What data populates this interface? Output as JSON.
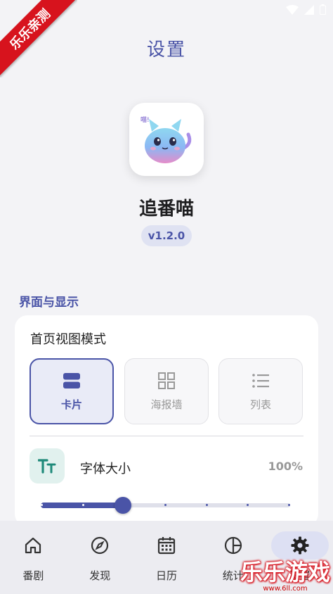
{
  "status_bar": {
    "icons": [
      "wifi-icon",
      "signal-icon",
      "battery-icon"
    ]
  },
  "ribbon": {
    "text": "乐乐亲测"
  },
  "header": {
    "title": "设置"
  },
  "app": {
    "name": "追番喵",
    "version": "v1.2.0",
    "icon_text": "喵!"
  },
  "section": {
    "label": "界面与显示"
  },
  "view_mode": {
    "title": "首页视图模式",
    "options": [
      {
        "label": "卡片",
        "icon": "card-view-icon",
        "selected": true
      },
      {
        "label": "海报墙",
        "icon": "grid-view-icon",
        "selected": false
      },
      {
        "label": "列表",
        "icon": "list-view-icon",
        "selected": false
      }
    ]
  },
  "font_size": {
    "label": "字体大小",
    "value_text": "100%",
    "slider_fraction": 0.33,
    "steps": 7
  },
  "bottom_nav": {
    "items": [
      {
        "label": "番剧",
        "icon": "home-icon",
        "active": false
      },
      {
        "label": "发现",
        "icon": "compass-icon",
        "active": false
      },
      {
        "label": "日历",
        "icon": "calendar-icon",
        "active": false
      },
      {
        "label": "统计",
        "icon": "pie-chart-icon",
        "active": false
      },
      {
        "label": "设置",
        "icon": "gear-icon",
        "active": true
      }
    ]
  },
  "watermark": {
    "text": "乐乐游戏",
    "url": "www.6ll.com"
  },
  "colors": {
    "accent": "#4a54a7",
    "accent_light": "#e9ebf7",
    "teal": "#1f8a7a",
    "ribbon": "#d7131d"
  }
}
